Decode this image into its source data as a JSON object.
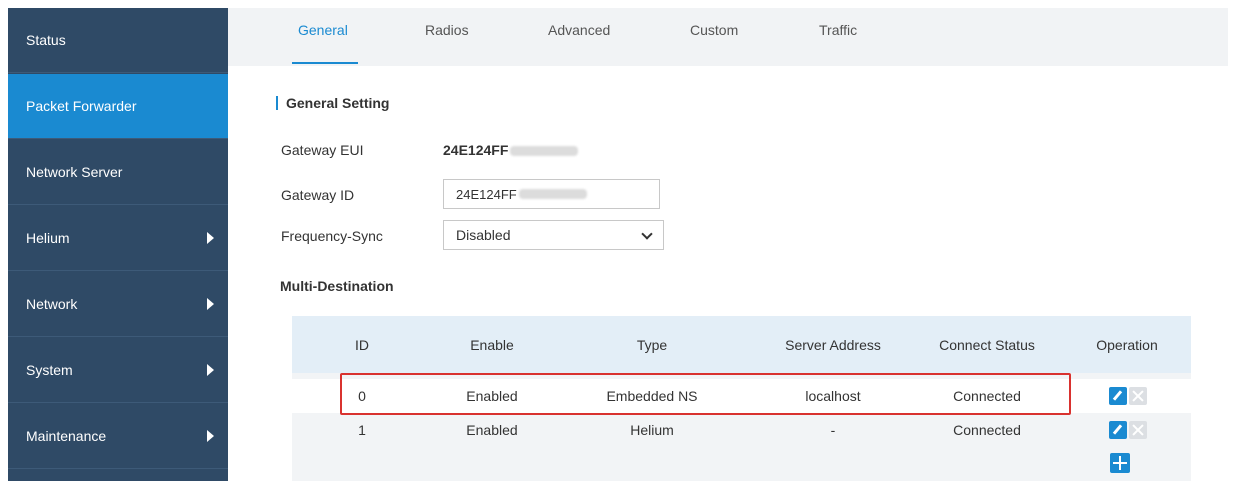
{
  "sidebar": {
    "items": [
      {
        "label": "Status",
        "has_submenu": false,
        "active": false
      },
      {
        "label": "Packet Forwarder",
        "has_submenu": false,
        "active": true
      },
      {
        "label": "Network Server",
        "has_submenu": false,
        "active": false
      },
      {
        "label": "Helium",
        "has_submenu": true,
        "active": false
      },
      {
        "label": "Network",
        "has_submenu": true,
        "active": false
      },
      {
        "label": "System",
        "has_submenu": true,
        "active": false
      },
      {
        "label": "Maintenance",
        "has_submenu": true,
        "active": false
      }
    ]
  },
  "tabs": [
    {
      "label": "General",
      "active": true
    },
    {
      "label": "Radios",
      "active": false
    },
    {
      "label": "Advanced",
      "active": false
    },
    {
      "label": "Custom",
      "active": false
    },
    {
      "label": "Traffic",
      "active": false
    }
  ],
  "general": {
    "section_title": "General Setting",
    "gateway_eui_label": "Gateway EUI",
    "gateway_eui_value": "24E124FF",
    "gateway_id_label": "Gateway ID",
    "gateway_id_value": "24E124FF",
    "frequency_sync_label": "Frequency-Sync",
    "frequency_sync_value": "Disabled"
  },
  "multi_destination": {
    "title": "Multi-Destination",
    "columns": [
      "ID",
      "Enable",
      "Type",
      "Server Address",
      "Connect Status",
      "Operation"
    ],
    "rows": [
      {
        "id": "0",
        "enable": "Enabled",
        "type": "Embedded NS",
        "server_address": "localhost",
        "connect_status": "Connected"
      },
      {
        "id": "1",
        "enable": "Enabled",
        "type": "Helium",
        "server_address": "-",
        "connect_status": "Connected"
      }
    ]
  },
  "colors": {
    "sidebar_bg": "#2f4a66",
    "sidebar_active": "#1a8ad1",
    "accent": "#1a8ad1",
    "highlight_border": "#d9322f"
  },
  "icons": {
    "submenu": "chevron-right-icon",
    "edit": "pencil-icon",
    "delete": "close-icon",
    "add": "plus-icon",
    "dropdown": "chevron-down-icon"
  }
}
